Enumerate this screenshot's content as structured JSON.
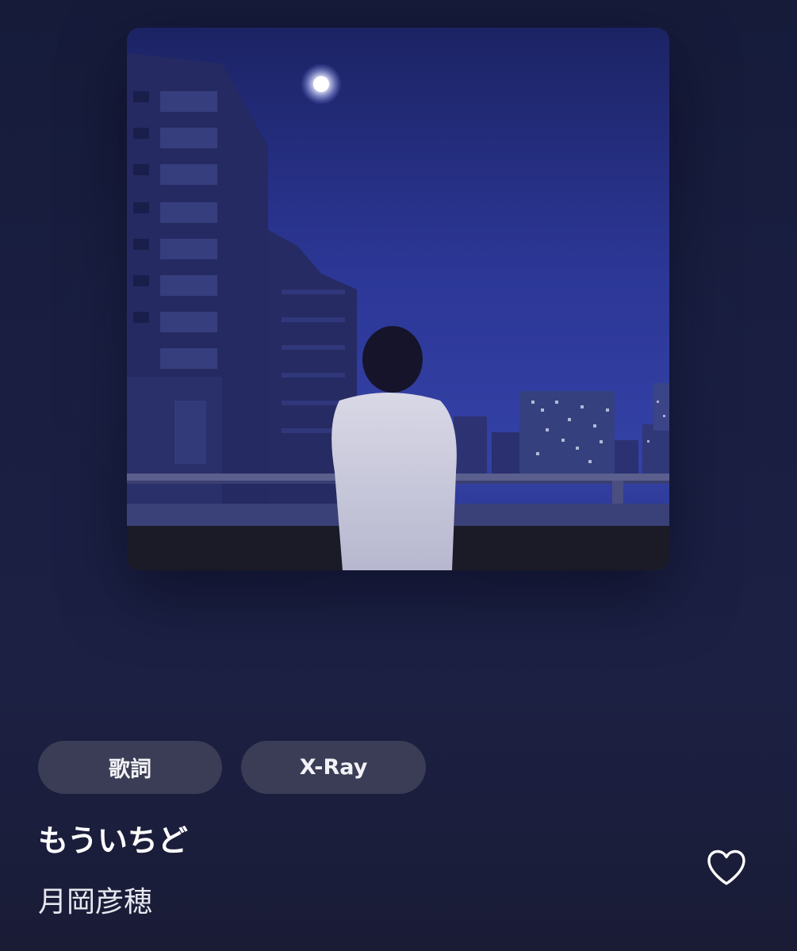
{
  "now_playing": {
    "album_art": {
      "icon": "album-cover-night-rooftop",
      "palette": [
        "#1f2669",
        "#3a46a8",
        "#2e3780",
        "#e8e8f0"
      ]
    },
    "actions": {
      "lyrics_label": "歌詞",
      "xray_label": "X-Ray"
    },
    "track": {
      "title": "もういちど",
      "artist": "月岡彦穂"
    },
    "favorite": {
      "icon": "heart-outline-icon",
      "is_favorited": false
    }
  }
}
